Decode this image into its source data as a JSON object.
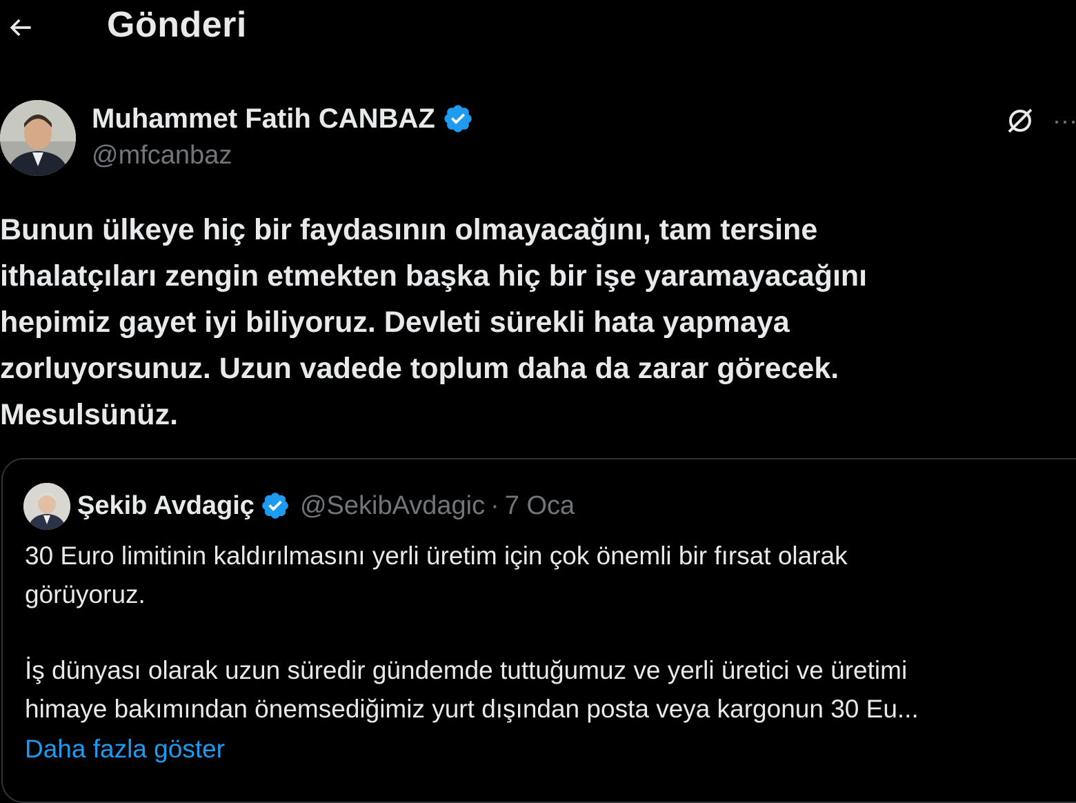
{
  "header": {
    "title": "Gönderi",
    "back_icon": "arrow-left-icon"
  },
  "post": {
    "author": {
      "name": "Muhammet Fatih CANBAZ",
      "handle": "@mfcanbaz",
      "verified": true
    },
    "text": "Bunun ülkeye hiç bir faydasının olmayacağını, tam tersine\nithalatçıları zengin etmekten başka hiç bir işe yaramayacağını\nhepimiz gayet iyi biliyoruz. Devleti sürekli hata yapmaya\nzorluyorsunuz. Uzun vadede toplum daha da zarar görecek.\nMesulsünüz.",
    "grok_icon": "grok-icon",
    "more_label": "···"
  },
  "quote": {
    "author": {
      "name": "Şekib Avdagiç",
      "handle": "@SekibAvdagic",
      "verified": true
    },
    "separator": "·",
    "date": "7 Oca",
    "paragraph1": "30 Euro limitinin kaldırılmasını yerli üretim için çok önemli bir fırsat olarak\ngörüyoruz.",
    "paragraph2": "İş dünyası olarak uzun süredir gündemde tuttuğumuz ve yerli üretici ve üretimi\nhimaye bakımından önemsediğimiz yurt dışından posta veya kargonun 30 Eu...",
    "show_more": "Daha fazla göster"
  },
  "colors": {
    "background": "#000000",
    "text_primary": "#e7e9ea",
    "text_secondary": "#71767b",
    "link": "#1d9bf0",
    "verified": "#1d9bf0",
    "border": "#2f3336"
  }
}
